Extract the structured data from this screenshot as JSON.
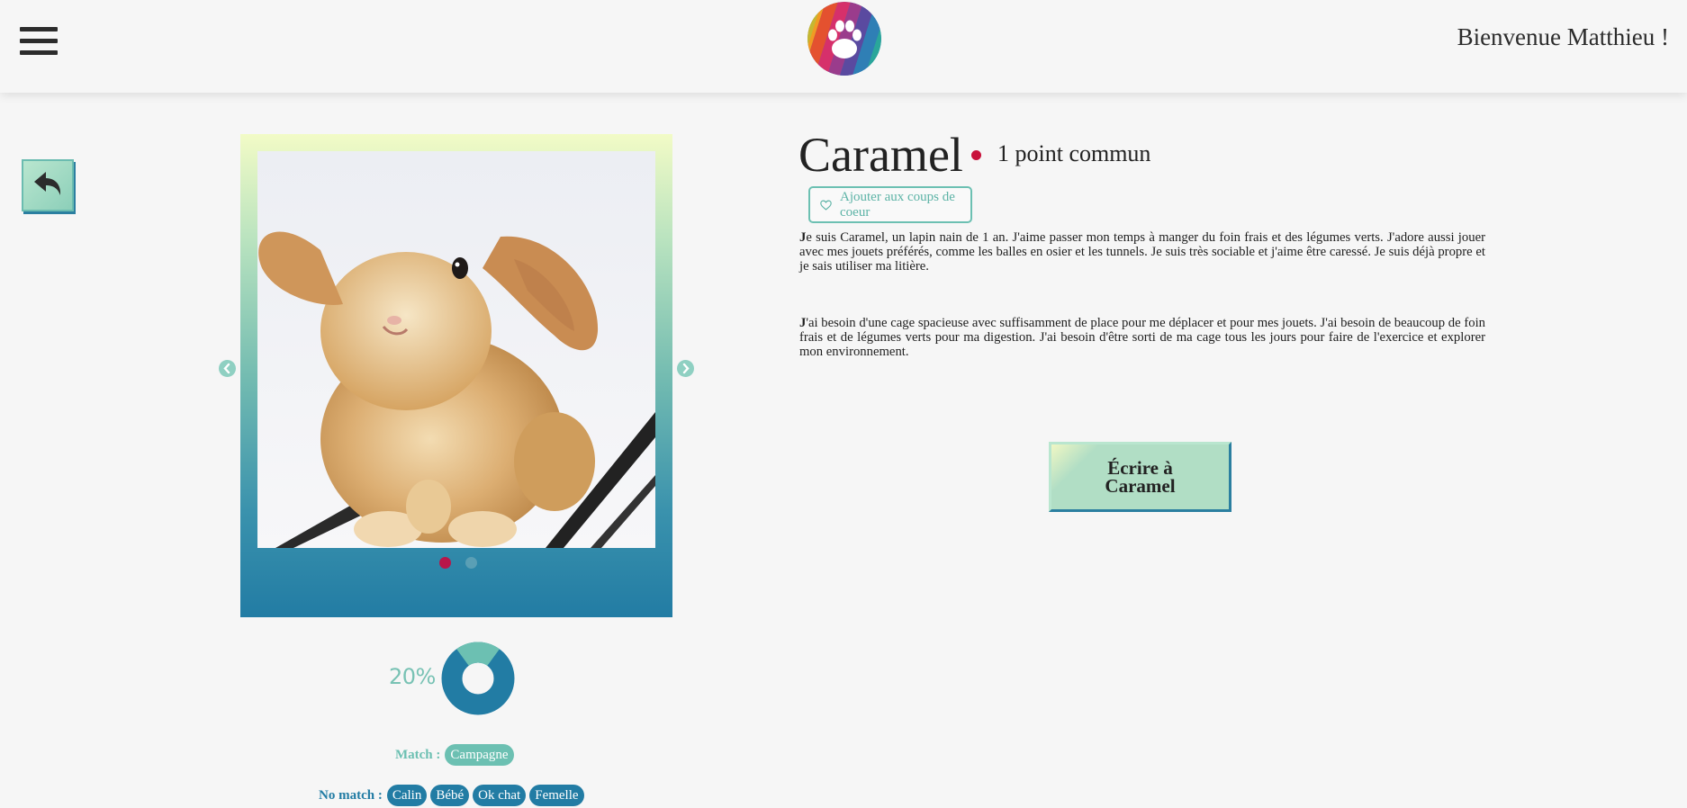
{
  "header": {
    "welcome": "Bienvenue Matthieu !",
    "menu_icon": "hamburger-menu-icon",
    "logo_icon": "paw-logo-icon"
  },
  "back_icon": "back-arrow-icon",
  "pet": {
    "name": "Caramel",
    "common_points": "1 point commun",
    "favorite_label": "Ajouter aux coups de coeur",
    "description_1_initial": "J",
    "description_1_rest": "e suis Caramel, un lapin nain de 1 an. J'aime passer mon temps à manger du foin frais et des légumes verts. J'adore aussi jouer avec mes jouets préférés, comme les balles en osier et les tunnels. Je suis très sociable et j'aime être caressé. Je suis déjà propre et je sais utiliser ma litière.",
    "description_2_initial": "J",
    "description_2_rest": "'ai besoin d'une cage spacieuse avec suffisamment de place pour me déplacer et pour mes jouets. J'ai besoin de beaucoup de foin frais et de légumes verts pour ma digestion. J'ai besoin d'être sorti de ma cage tous les jours pour faire de l'exercice et explorer mon environnement.",
    "write_label_line1": "Écrire à",
    "write_label_line2": "Caramel"
  },
  "carousel": {
    "slide_count": 2,
    "active_index": 0,
    "prev_icon": "chevron-left-icon",
    "next_icon": "chevron-right-icon"
  },
  "compatibility": {
    "percent_label": "20%",
    "fraction": 0.2
  },
  "match": {
    "label": "Match :",
    "tags": [
      "Campagne"
    ],
    "no_match_label": "No match :",
    "no_match_tags": [
      "Calin",
      "Bébé",
      "Ok chat",
      "Femelle"
    ]
  },
  "colors": {
    "teal": "#6cc0b2",
    "blue": "#227ca4",
    "crimson": "#c8103a"
  }
}
